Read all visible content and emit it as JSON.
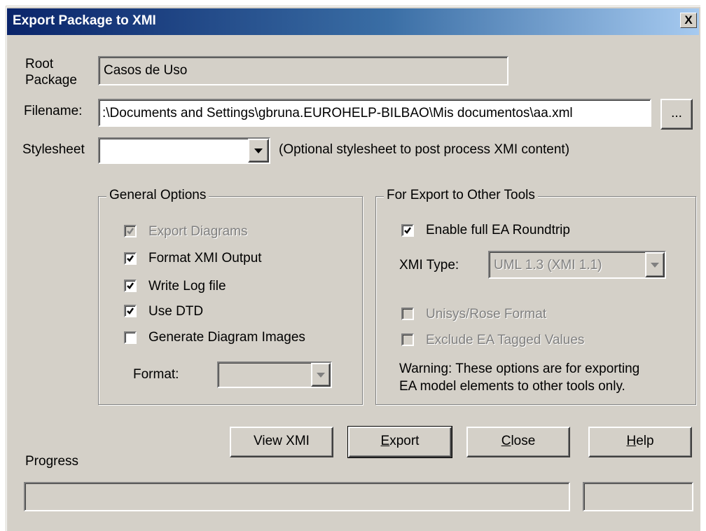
{
  "window": {
    "title": "Export Package to XMI",
    "close_label": "X"
  },
  "root_package": {
    "label_line1": "Root",
    "label_line2": "Package",
    "value": "Casos de Uso"
  },
  "filename": {
    "label": "Filename:",
    "value": ":\\Documents and Settings\\gbruna.EUROHELP-BILBAO\\Mis documentos\\aa.xml",
    "browse_label": "..."
  },
  "stylesheet": {
    "label": "Stylesheet",
    "value": "",
    "hint": "(Optional stylesheet to post process XMI content)"
  },
  "general_options": {
    "title": "General Options",
    "items": [
      {
        "label": "Export Diagrams",
        "checked": true,
        "enabled": false
      },
      {
        "label": "Format XMI Output",
        "checked": true,
        "enabled": true
      },
      {
        "label": "Write Log file",
        "checked": true,
        "enabled": true
      },
      {
        "label": "Use DTD",
        "checked": true,
        "enabled": true
      },
      {
        "label": "Generate Diagram Images",
        "checked": false,
        "enabled": true
      }
    ],
    "format_label": "Format:",
    "format_value": ""
  },
  "export_other": {
    "title": "For Export to Other Tools",
    "roundtrip_label": "Enable full EA Roundtrip",
    "roundtrip_checked": true,
    "xmi_type_label": "XMI Type:",
    "xmi_type_value": "UML 1.3 (XMI 1.1)",
    "unisys_label": "Unisys/Rose Format",
    "exclude_label": "Exclude EA Tagged Values",
    "warning_line1": "Warning: These options are for exporting",
    "warning_line2": "EA model elements to other tools only."
  },
  "buttons": {
    "view_xmi": "View XMI",
    "export_mn": "E",
    "export_rest": "xport",
    "close_mn": "C",
    "close_rest": "lose",
    "help_mn": "H",
    "help_rest": "elp"
  },
  "progress": {
    "label": "Progress",
    "value": 0
  }
}
